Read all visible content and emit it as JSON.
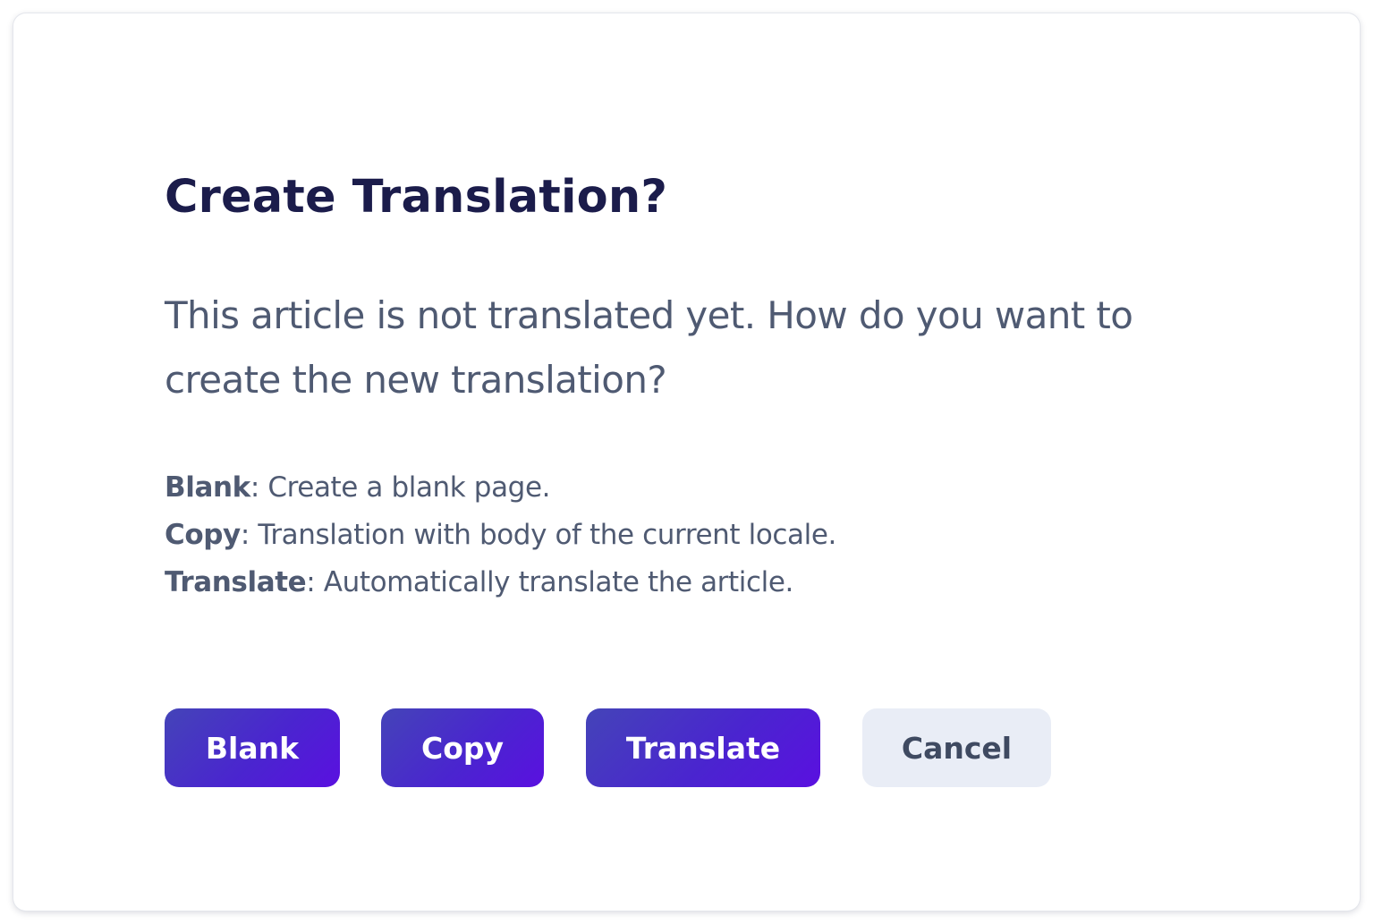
{
  "dialog": {
    "title": "Create Translation?",
    "message": "This article is not translated yet. How do you want to create the new translation?",
    "options": [
      {
        "name": "Blank",
        "description": ": Create a blank page."
      },
      {
        "name": "Copy",
        "description": ": Translation with body of the current locale."
      },
      {
        "name": "Translate",
        "description": ": Automatically translate the article."
      }
    ],
    "buttons": {
      "blank": "Blank",
      "copy": "Copy",
      "translate": "Translate",
      "cancel": "Cancel"
    }
  },
  "colors": {
    "title": "#1b1c4b",
    "text": "#4f5a72",
    "primary_button_start": "#4444b8",
    "primary_button_end": "#5a10e0",
    "secondary_button": "#e9edf6"
  }
}
